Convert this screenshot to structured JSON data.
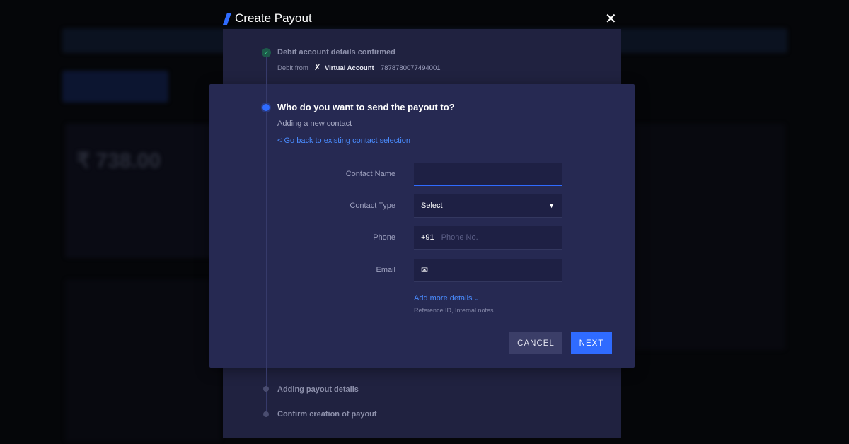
{
  "background": {
    "balance": "₹ 738.00"
  },
  "modal": {
    "title": "Create Payout",
    "steps": [
      {
        "title": "Debit account details confirmed",
        "status": "done",
        "debit_from_label": "Debit from",
        "account_name": "Virtual Account",
        "account_number": "7878780077494001"
      },
      {
        "title": "Who do you want to send the payout to?",
        "status": "active",
        "subtitle": "Adding a new contact",
        "back_link": "< Go back to existing contact selection"
      },
      {
        "title": "Adding payout details",
        "status": "pending"
      },
      {
        "title": "Confirm creation of payout",
        "status": "pending"
      }
    ],
    "form": {
      "contact_name_label": "Contact Name",
      "contact_name_value": "",
      "contact_type_label": "Contact Type",
      "contact_type_value": "Select",
      "phone_label": "Phone",
      "phone_prefix": "+91",
      "phone_placeholder": "Phone No.",
      "email_label": "Email",
      "email_value": "",
      "add_more": "Add more details",
      "add_more_hint": "Reference ID, Internal notes"
    },
    "cancel_label": "CANCEL",
    "next_label": "NEXT"
  },
  "colors": {
    "accent": "#2f6bff",
    "success": "#1fb36b",
    "link": "#4a8cff"
  }
}
